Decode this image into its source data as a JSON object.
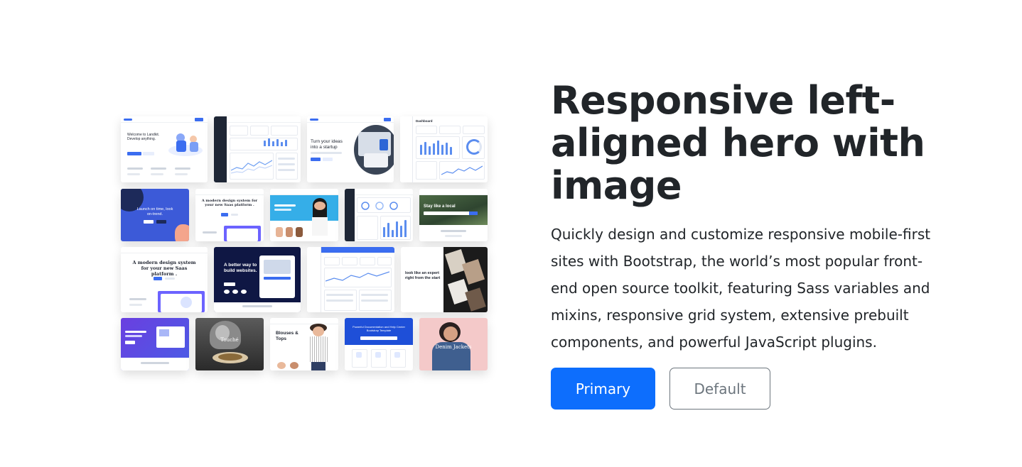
{
  "hero": {
    "title": "Responsive left-aligned hero with image",
    "lead": "Quickly design and customize responsive mobile-first sites with Bootstrap, the world’s most popular front-end open source toolkit, featuring Sass variables and mixins, responsive grid system, extensive prebuilt components, and powerful JavaScript plugins.",
    "primary_button": "Primary",
    "default_button": "Default"
  },
  "collage": {
    "tiles": {
      "landkit": "Welcome to Landkit. Develop anything.",
      "startup": "Turn your ideas into a startup",
      "dashboard": "Dashboard",
      "launch": "Launch on time, look on-trend.",
      "design_system": "A modern design system for your new Saas platform .",
      "stay_local": "Stay like a local",
      "design_system_2": "A modern design system for your new Saas platform .",
      "better_way": "A better way to build websites.",
      "expert": "look like an expert right from the start",
      "blouses": "Blouses & Tops",
      "denim": "Denim Jackets",
      "touche": "Touché",
      "documentation": "Powerful Documentation and Help Center Bootstrap Template"
    }
  },
  "colors": {
    "primary": "#0d6efd",
    "secondary": "#6c757d",
    "heading": "#212529"
  }
}
